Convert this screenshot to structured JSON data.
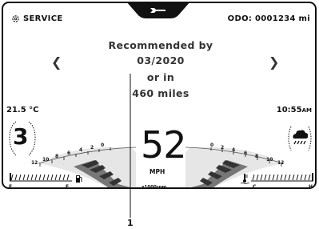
{
  "header": {
    "service_label": "SERVICE",
    "odo_label": "ODO: 0001234 mi"
  },
  "service_message": {
    "line1": "Recommended by",
    "line2": "03/2020",
    "line3": "or in",
    "line4": "460 miles"
  },
  "temperature": "21.5 °C",
  "clock": {
    "time": "10:55",
    "ampm": "AM"
  },
  "gear": "3",
  "speed": {
    "value": "52",
    "unit": "MPH"
  },
  "rpm_unit": "x1000rpm",
  "tacho_left_ticks": [
    "12",
    "10",
    "8",
    "6",
    "4",
    "2",
    "0"
  ],
  "tacho_right_ticks": [
    "0",
    "2",
    "4",
    "6",
    "8",
    "10",
    "12"
  ],
  "fuel": {
    "full": "F",
    "empty": "E"
  },
  "coolant": {
    "cold": "C",
    "hot": "H"
  },
  "weather_icon": "cloud-rain-icon",
  "callout_label": "1"
}
